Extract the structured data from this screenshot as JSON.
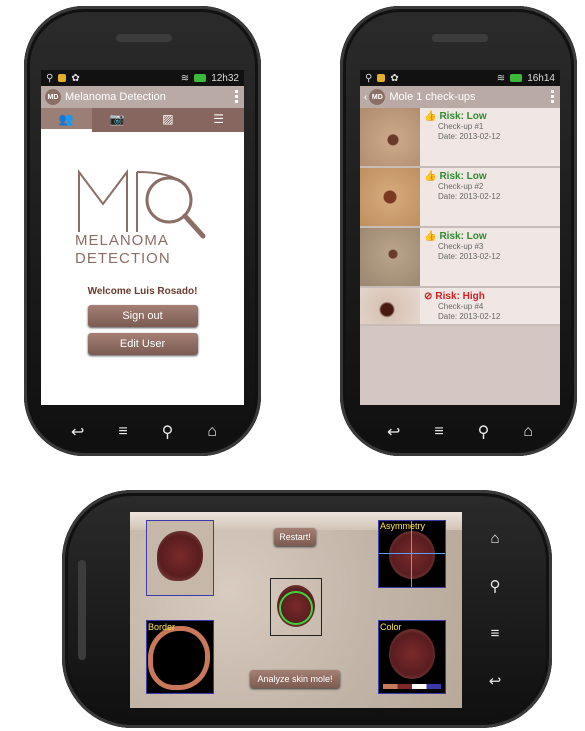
{
  "phone1": {
    "status_time": "12h32",
    "app_title": "Melanoma Detection",
    "tabs": [
      "user-icon",
      "camera-icon",
      "gallery-icon",
      "list-icon"
    ],
    "logo_letters": "MD",
    "logo_line1": "MELANOMA",
    "logo_line2": "DETECTION",
    "welcome": "Welcome Luis Rosado!",
    "sign_out": "Sign out",
    "edit_user": "Edit User"
  },
  "phone2": {
    "status_time": "16h14",
    "title": "Mole 1 check-ups",
    "checkups": [
      {
        "risk": "Risk: Low",
        "checkup": "Check-up #1",
        "date": "Date: 2013-02-12",
        "level": "low"
      },
      {
        "risk": "Risk: Low",
        "checkup": "Check-up #2",
        "date": "Date: 2013-02-12",
        "level": "low"
      },
      {
        "risk": "Risk: Low",
        "checkup": "Check-up #3",
        "date": "Date: 2013-02-12",
        "level": "low"
      },
      {
        "risk": "Risk: High",
        "checkup": "Check-up #4",
        "date": "Date: 2013-02-12",
        "level": "high"
      }
    ]
  },
  "phone3": {
    "restart": "Restart!",
    "analyze": "Analyze skin mole!",
    "label_asymmetry": "Asymmetry",
    "label_border": "Border",
    "label_color": "Color"
  },
  "colors": {
    "accent": "#86665e",
    "low": "#2e8b2e",
    "high": "#d42020"
  }
}
